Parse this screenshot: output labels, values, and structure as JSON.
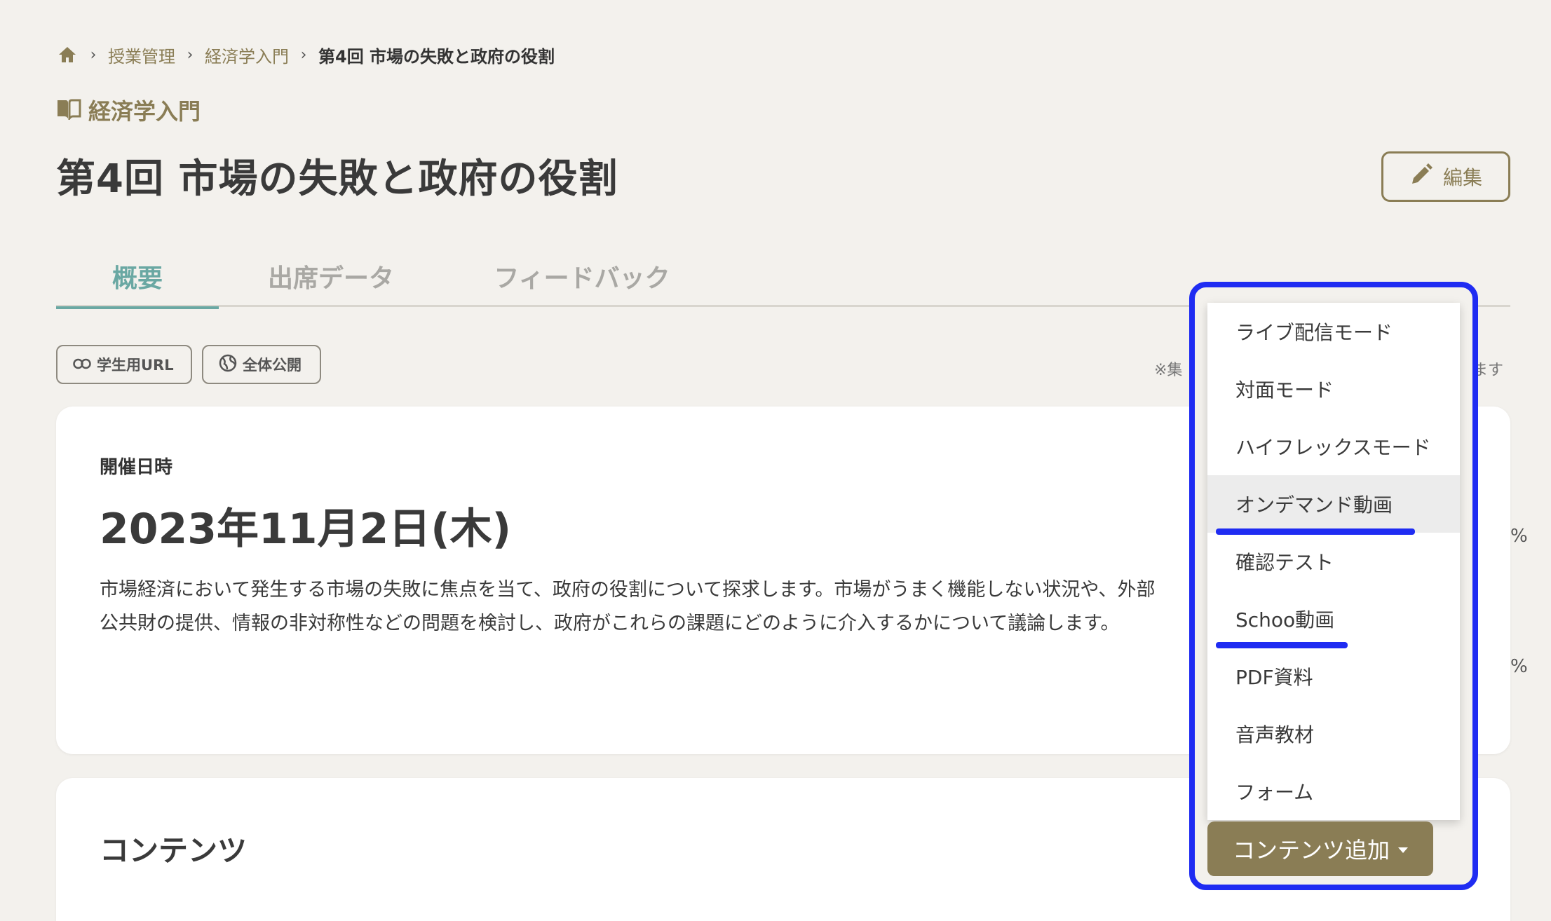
{
  "breadcrumb": {
    "home_icon": "home-icon",
    "items": [
      "授業管理",
      "経済学入門"
    ],
    "current": "第4回 市場の失敗と政府の役割"
  },
  "course": {
    "icon": "book-icon",
    "name": "経済学入門"
  },
  "page_title": "第4回 市場の失敗と政府の役割",
  "edit_button": {
    "icon": "pencil-icon",
    "label": "編集"
  },
  "tabs": [
    {
      "label": "概要",
      "active": true
    },
    {
      "label": "出席データ",
      "active": false
    },
    {
      "label": "フィードバック",
      "active": false
    }
  ],
  "pills": [
    {
      "icon": "link-icon",
      "label": "学生用URL"
    },
    {
      "icon": "globe-icon",
      "label": "全体公開"
    }
  ],
  "note": {
    "head": "※集",
    "tail": "れます"
  },
  "overview": {
    "date_label": "開催日時",
    "date_value": "2023年11月2日(木)",
    "description_line1": "市場経済において発生する市場の失敗に焦点を当て、政府の役割について探求します。市場がうまく機能しない状況や、外部",
    "description_line2": "公共財の提供、情報の非対称性などの問題を検討し、政府がこれらの課題にどのように介入するかについて議論します。",
    "pct_1": "%",
    "pct_2": "%"
  },
  "contents": {
    "title": "コンテンツ"
  },
  "dropdown": {
    "items": [
      {
        "label": "ライブ配信モード"
      },
      {
        "label": "対面モード"
      },
      {
        "label": "ハイフレックスモード"
      },
      {
        "label": "オンデマンド動画",
        "hovered": true
      },
      {
        "label": "確認テスト"
      },
      {
        "label": "Schoo動画"
      },
      {
        "label": "PDF資料"
      },
      {
        "label": "音声教材"
      },
      {
        "label": "フォーム"
      }
    ]
  },
  "add_button": {
    "label": "コンテンツ追加",
    "icon": "caret-down-icon"
  },
  "colors": {
    "brand": "#8a7d55",
    "tab_active": "#6aa8a3",
    "annotation": "#1f2cf2",
    "background": "#f3f1ed"
  }
}
